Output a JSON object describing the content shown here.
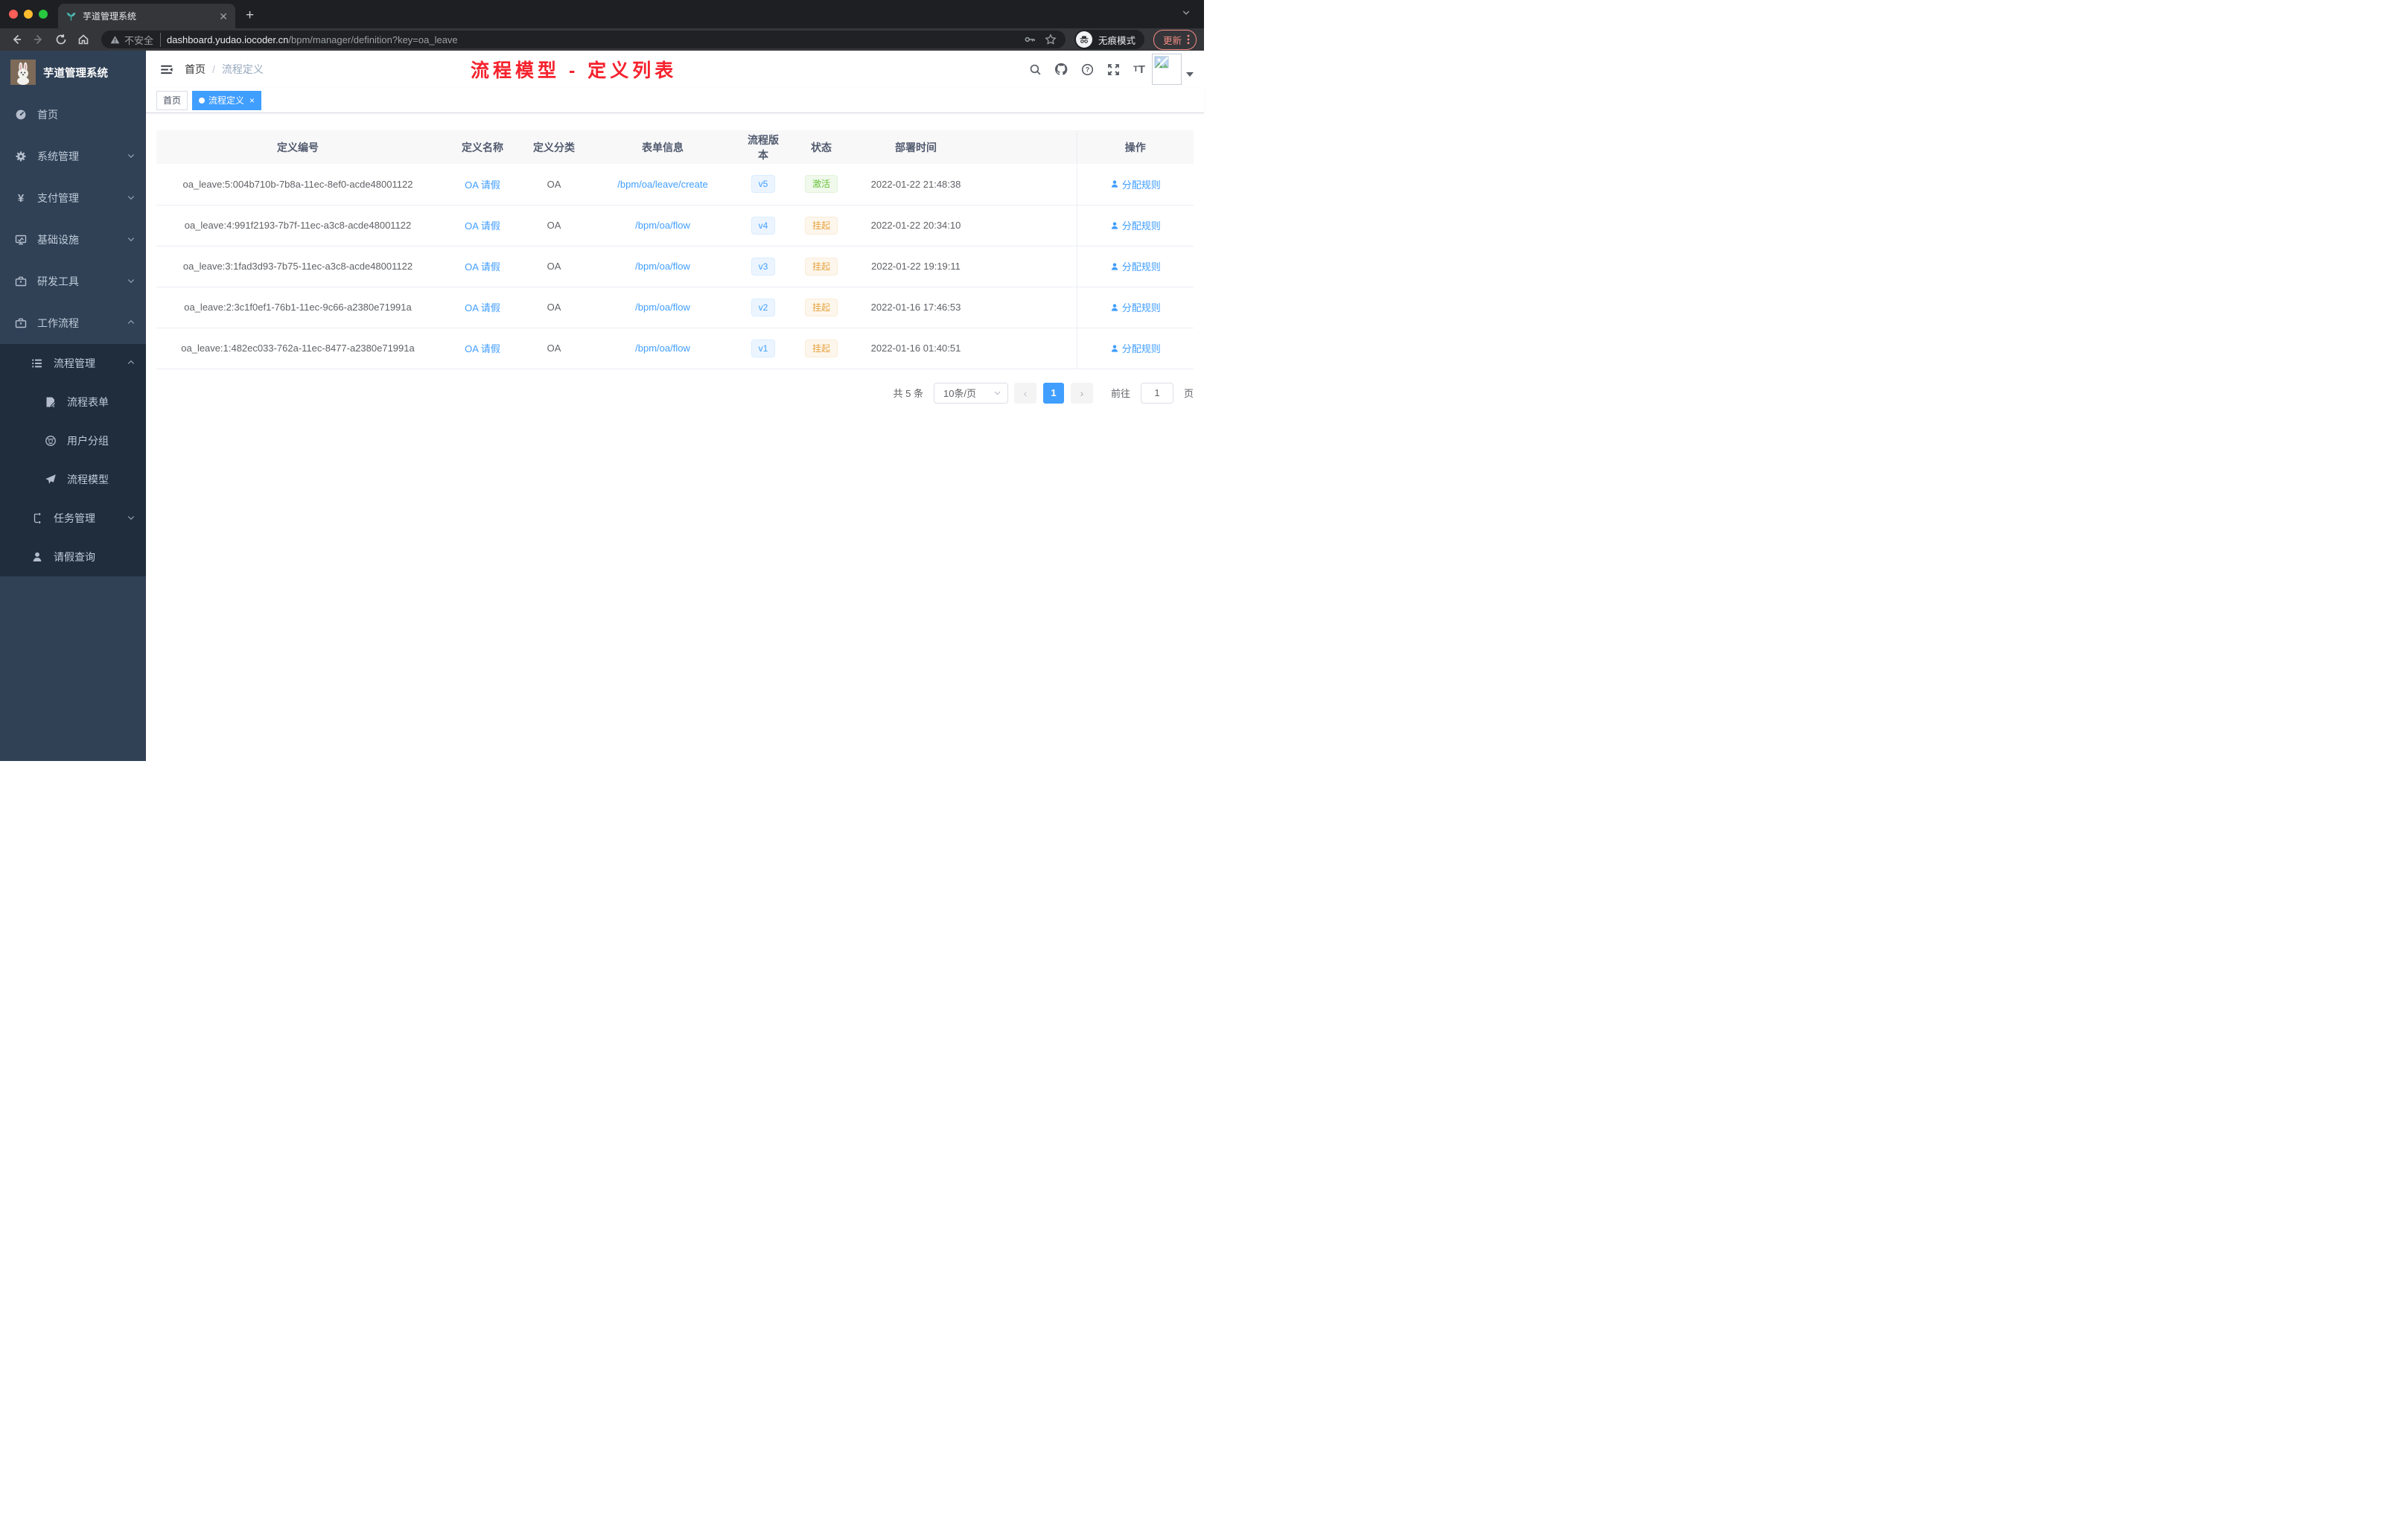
{
  "colors": {
    "accent": "#409eff",
    "success": "#67c23a",
    "warning": "#e6a23c",
    "annotation_red": "#f5222d",
    "sidebar_bg": "#304156",
    "submenu_bg": "#1f2d3d"
  },
  "browser": {
    "tab_title": "芋道管理系统",
    "new_tab_glyph": "+",
    "security_label": "不安全",
    "url_host": "dashboard.yudao.iocoder.cn",
    "url_path": "/bpm/manager/definition?key=oa_leave",
    "incognito_label": "无痕模式",
    "update_label": "更新"
  },
  "sidebar": {
    "logo_title": "芋道管理系统",
    "items": [
      {
        "label": "首页",
        "icon": "gauge-icon"
      },
      {
        "label": "系统管理",
        "icon": "gear-icon",
        "state": "collapsed"
      },
      {
        "label": "支付管理",
        "icon": "yen-icon",
        "state": "collapsed"
      },
      {
        "label": "基础设施",
        "icon": "monitor-icon",
        "state": "collapsed"
      },
      {
        "label": "研发工具",
        "icon": "toolbox-icon",
        "state": "collapsed"
      },
      {
        "label": "工作流程",
        "icon": "briefcase-icon",
        "state": "expanded"
      }
    ],
    "workflow_children": [
      {
        "label": "流程管理",
        "icon": "list-icon",
        "state": "expanded"
      },
      {
        "label": "流程表单",
        "icon": "form-icon"
      },
      {
        "label": "用户分组",
        "icon": "group-icon"
      },
      {
        "label": "流程模型",
        "icon": "send-icon"
      },
      {
        "label": "任务管理",
        "icon": "tasks-icon",
        "state": "collapsed"
      },
      {
        "label": "请假查询",
        "icon": "user-icon"
      }
    ]
  },
  "header": {
    "breadcrumb_home": "首页",
    "breadcrumb_sep": "/",
    "breadcrumb_current": "流程定义",
    "annotation_title": "流程模型 - 定义列表"
  },
  "tags": {
    "home": "首页",
    "active": "流程定义",
    "close_glyph": "×"
  },
  "table": {
    "columns": [
      "定义编号",
      "定义名称",
      "定义分类",
      "表单信息",
      "流程版本",
      "状态",
      "部署时间",
      "操作"
    ],
    "rows": [
      {
        "id": "oa_leave:5:004b710b-7b8a-11ec-8ef0-acde48001122",
        "name": "OA 请假",
        "category": "OA",
        "form": "/bpm/oa/leave/create",
        "version": "v5",
        "status": "激活",
        "status_type": "success",
        "deploy_time": "2022-01-22 21:48:38",
        "action": "分配规则"
      },
      {
        "id": "oa_leave:4:991f2193-7b7f-11ec-a3c8-acde48001122",
        "name": "OA 请假",
        "category": "OA",
        "form": "/bpm/oa/flow",
        "version": "v4",
        "status": "挂起",
        "status_type": "warning",
        "deploy_time": "2022-01-22 20:34:10",
        "action": "分配规则"
      },
      {
        "id": "oa_leave:3:1fad3d93-7b75-11ec-a3c8-acde48001122",
        "name": "OA 请假",
        "category": "OA",
        "form": "/bpm/oa/flow",
        "version": "v3",
        "status": "挂起",
        "status_type": "warning",
        "deploy_time": "2022-01-22 19:19:11",
        "action": "分配规则"
      },
      {
        "id": "oa_leave:2:3c1f0ef1-76b1-11ec-9c66-a2380e71991a",
        "name": "OA 请假",
        "category": "OA",
        "form": "/bpm/oa/flow",
        "version": "v2",
        "status": "挂起",
        "status_type": "warning",
        "deploy_time": "2022-01-16 17:46:53",
        "action": "分配规则"
      },
      {
        "id": "oa_leave:1:482ec033-762a-11ec-8477-a2380e71991a",
        "name": "OA 请假",
        "category": "OA",
        "form": "/bpm/oa/flow",
        "version": "v1",
        "status": "挂起",
        "status_type": "warning",
        "deploy_time": "2022-01-16 01:40:51",
        "action": "分配规则"
      }
    ]
  },
  "pagination": {
    "total_label": "共 5 条",
    "page_size": "10条/页",
    "prev_glyph": "‹",
    "next_glyph": "›",
    "current_page": "1",
    "goto_label": "前往",
    "goto_value": "1",
    "page_unit": "页"
  }
}
